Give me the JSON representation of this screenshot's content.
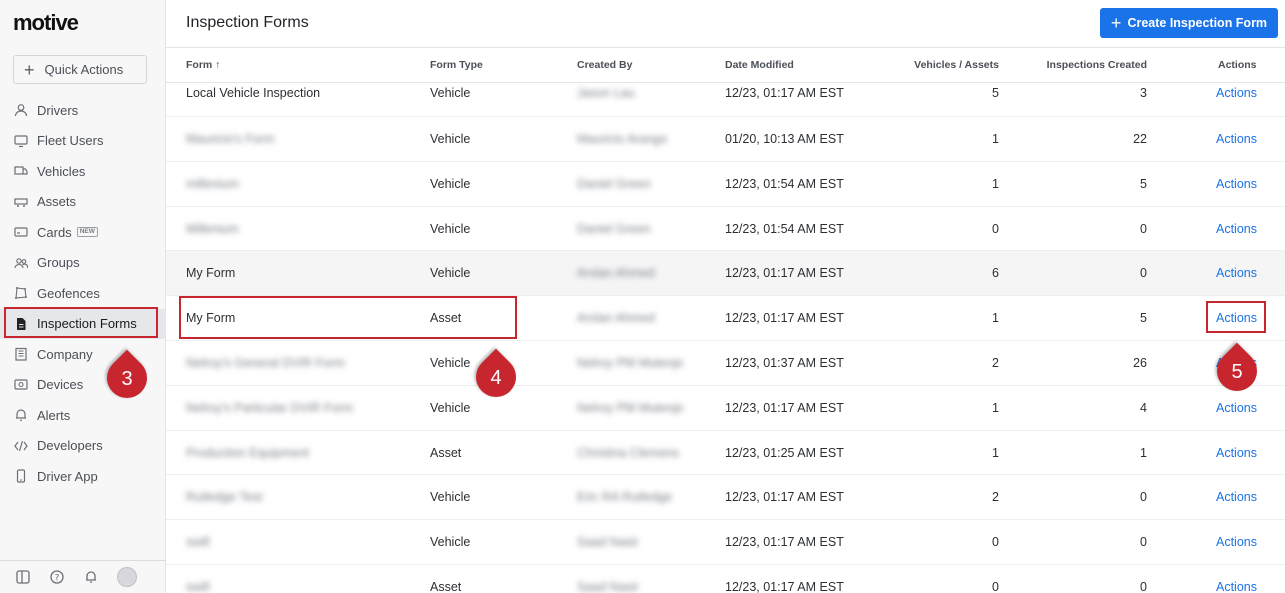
{
  "sidebar": {
    "logo": "motive",
    "quick_actions": "Quick Actions",
    "items": [
      {
        "label": "Drivers",
        "icon": "person-icon"
      },
      {
        "label": "Fleet Users",
        "icon": "monitor-icon"
      },
      {
        "label": "Vehicles",
        "icon": "truck-icon"
      },
      {
        "label": "Assets",
        "icon": "trailer-icon"
      },
      {
        "label": "Cards",
        "icon": "card-icon",
        "badge": "NEW"
      },
      {
        "label": "Groups",
        "icon": "groups-icon"
      },
      {
        "label": "Geofences",
        "icon": "geofence-icon"
      },
      {
        "label": "Inspection Forms",
        "icon": "document-icon",
        "active": true
      },
      {
        "label": "Company",
        "icon": "building-icon"
      },
      {
        "label": "Devices",
        "icon": "devices-icon"
      },
      {
        "label": "Alerts",
        "icon": "bell-icon"
      },
      {
        "label": "Developers",
        "icon": "code-icon"
      },
      {
        "label": "Driver App",
        "icon": "phone-icon"
      }
    ]
  },
  "header": {
    "title": "Inspection Forms",
    "create_button": "Create Inspection Form"
  },
  "table": {
    "columns": {
      "form": "Form ↑",
      "type": "Form Type",
      "created_by": "Created By",
      "date": "Date Modified",
      "vehicles": "Vehicles / Assets",
      "inspections": "Inspections Created",
      "actions": "Actions"
    },
    "rows": [
      {
        "form": "Local Vehicle Inspection",
        "form_blur": false,
        "type": "Vehicle",
        "created_by": "Jason Lau",
        "date": "12/23, 01:17 AM EST",
        "vehicles": "5",
        "inspections": "3",
        "action": "Actions"
      },
      {
        "form": "Mauricio's Form",
        "form_blur": true,
        "type": "Vehicle",
        "created_by": "Mauricio Arango",
        "date": "01/20, 10:13 AM EST",
        "vehicles": "1",
        "inspections": "22",
        "action": "Actions"
      },
      {
        "form": "millenium",
        "form_blur": true,
        "type": "Vehicle",
        "created_by": "Daniel Green",
        "date": "12/23, 01:54 AM EST",
        "vehicles": "1",
        "inspections": "5",
        "action": "Actions"
      },
      {
        "form": "Millenium",
        "form_blur": true,
        "type": "Vehicle",
        "created_by": "Daniel Green",
        "date": "12/23, 01:54 AM EST",
        "vehicles": "0",
        "inspections": "0",
        "action": "Actions"
      },
      {
        "form": "My Form",
        "form_blur": false,
        "type": "Vehicle",
        "created_by": "Arslan Ahmed",
        "date": "12/23, 01:17 AM EST",
        "vehicles": "6",
        "inspections": "0",
        "action": "Actions"
      },
      {
        "form": "My Form",
        "form_blur": false,
        "type": "Asset",
        "created_by": "Arslan Ahmed",
        "date": "12/23, 01:17 AM EST",
        "vehicles": "1",
        "inspections": "5",
        "action": "Actions"
      },
      {
        "form": "Nelroy's General DVIR Form",
        "form_blur": true,
        "type": "Vehicle",
        "created_by": "Nelroy PM Mutenje",
        "date": "12/23, 01:37 AM EST",
        "vehicles": "2",
        "inspections": "26",
        "action": "Actions"
      },
      {
        "form": "Nelroy's Particular DVIR Form",
        "form_blur": true,
        "type": "Vehicle",
        "created_by": "Nelroy PM Mutenje",
        "date": "12/23, 01:17 AM EST",
        "vehicles": "1",
        "inspections": "4",
        "action": "Actions"
      },
      {
        "form": "Production Equipment",
        "form_blur": true,
        "type": "Asset",
        "created_by": "Christina Clemens",
        "date": "12/23, 01:25 AM EST",
        "vehicles": "1",
        "inspections": "1",
        "action": "Actions"
      },
      {
        "form": "Rutledge Test",
        "form_blur": true,
        "type": "Vehicle",
        "created_by": "Eric RA Rutledge",
        "date": "12/23, 01:17 AM EST",
        "vehicles": "2",
        "inspections": "0",
        "action": "Actions"
      },
      {
        "form": "swill",
        "form_blur": true,
        "type": "Vehicle",
        "created_by": "Saad Nasir",
        "date": "12/23, 01:17 AM EST",
        "vehicles": "0",
        "inspections": "0",
        "action": "Actions"
      },
      {
        "form": "swill",
        "form_blur": true,
        "type": "Asset",
        "created_by": "Saad Nasir",
        "date": "12/23, 01:17 AM EST",
        "vehicles": "0",
        "inspections": "0",
        "action": "Actions"
      }
    ]
  },
  "annotations": [
    "3",
    "4",
    "5"
  ],
  "colors": {
    "accent": "#1a73e8",
    "callout": "#c8262e"
  }
}
